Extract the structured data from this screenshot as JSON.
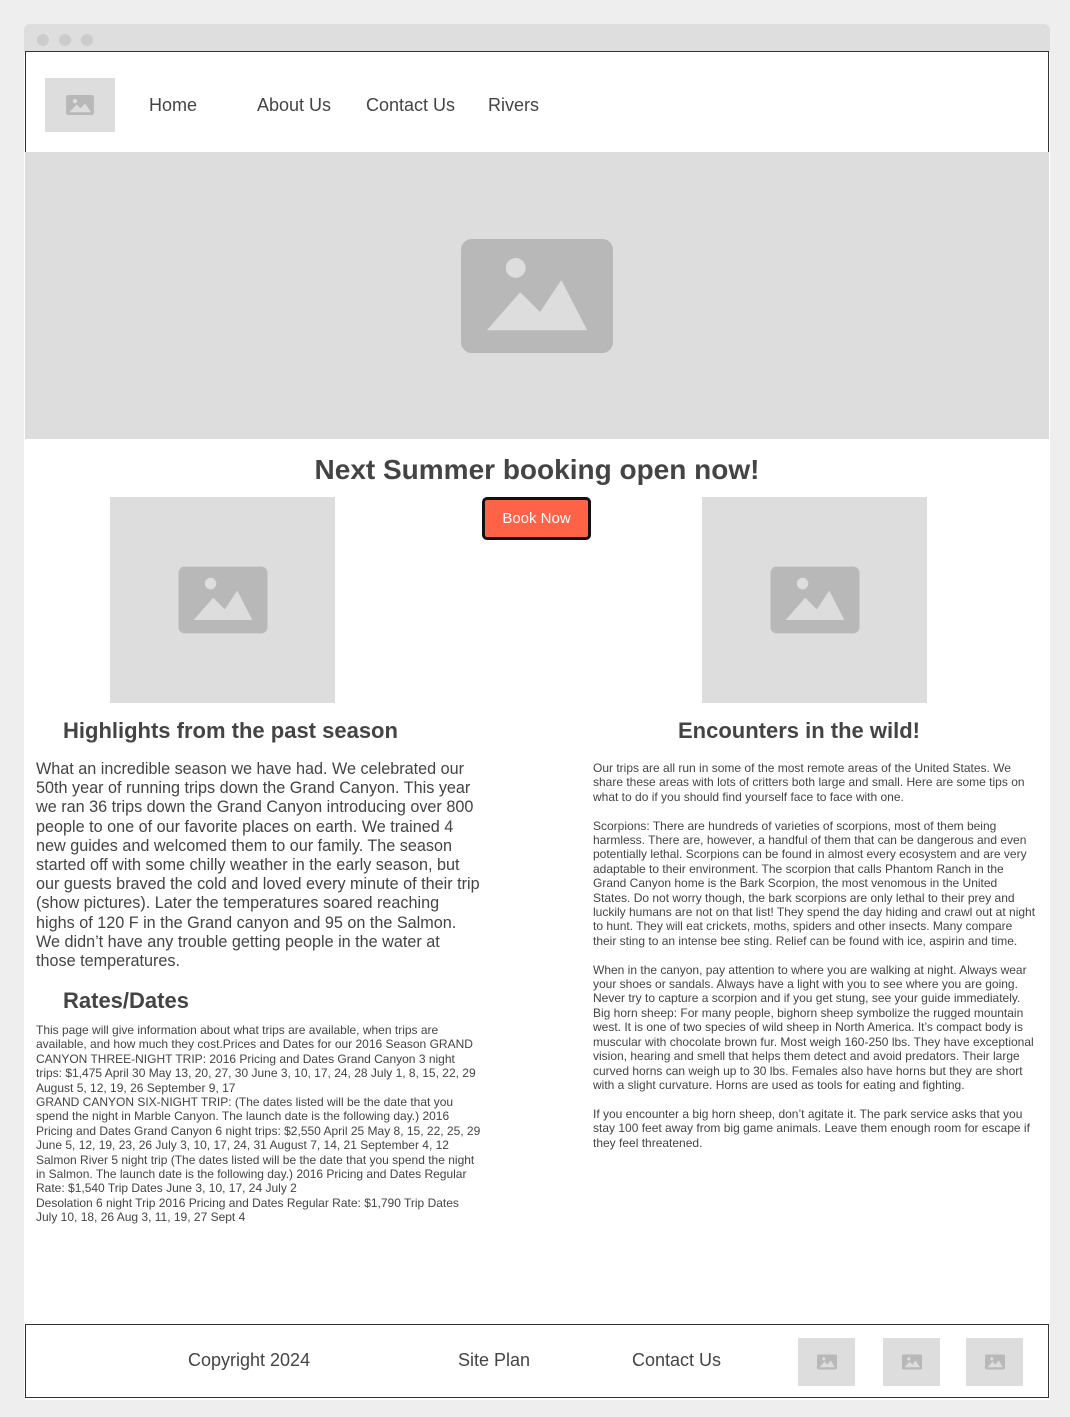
{
  "header": {
    "nav": [
      "Home",
      "About Us",
      "Contact Us",
      "Rivers"
    ]
  },
  "main": {
    "headline": "Next Summer booking open now!",
    "book_button": "Book Now",
    "highlights": {
      "title": "Highlights from the past season",
      "body": "What an incredible season we have had. We celebrated our 50th year of running trips down the Grand Canyon. This year we ran 36 trips down the Grand Canyon introducing over 800 people to one of our favorite places on earth. We trained 4 new guides and welcomed them to our family. The season started off with some chilly weather in the early season, but our guests braved the cold and loved every minute of their trip (show pictures). Later the temperatures soared reaching highs of 120 F in the Grand canyon and 95 on the Salmon. We didn’t have any trouble getting people in the water at those temperatures."
    },
    "rates": {
      "title": "Rates/Dates",
      "lines": [
        "This page will give information about what trips are available, when trips are available, and how much they cost.Prices and Dates for our 2016 Season GRAND CANYON THREE-NIGHT TRIP: 2016 Pricing and Dates Grand Canyon 3 night trips: $1,475 April 30 May 13, 20, 27, 30 June 3, 10, 17, 24, 28 July 1, 8, 15, 22, 29 August 5, 12, 19, 26 September 9, 17",
        "GRAND CANYON SIX-NIGHT TRIP: (The dates listed will be the date that you spend the night in Marble Canyon. The launch date is the following day.) 2016 Pricing and Dates Grand Canyon 6 night trips: $2,550 April 25 May 8, 15, 22, 25, 29 June 5, 12, 19, 23, 26 July 3, 10, 17, 24, 31 August 7, 14, 21 September 4, 12",
        "Salmon River 5 night trip (The dates listed will be the date that you spend the night in Salmon. The launch date is the following day.) 2016 Pricing and Dates Regular Rate: $1,540 Trip Dates June 3, 10, 17, 24 July 2",
        "Desolation 6 night Trip 2016 Pricing and Dates Regular Rate: $1,790 Trip Dates July 10, 18, 26 Aug 3, 11, 19, 27 Sept 4"
      ]
    },
    "encounters": {
      "title": "Encounters in the wild!",
      "paragraphs": [
        "Our trips are all run in some of the most remote areas of the United States. We share these areas with lots of critters both large and small. Here are some tips on what to do if you should find yourself face to face with one.",
        "Scorpions: There are hundreds of varieties of scorpions, most of them being harmless. There are, however, a handful of them that can be dangerous and even potentially lethal. Scorpions can be found in almost every ecosystem and are very adaptable to their environment. The scorpion that calls Phantom Ranch in the Grand Canyon home is the Bark Scorpion, the most venomous in the United States. Do not worry though, the bark scorpions are only lethal to their prey and luckily humans are not on that list! They spend the day hiding and crawl out at night to hunt. They will eat crickets, moths, spiders and other insects. Many compare their sting to an intense bee sting. Relief can be found with ice, aspirin and time.",
        "When in the canyon, pay attention to where you are walking at night. Always wear your shoes or sandals. Always have a light with you to see where you are going. Never try to capture a scorpion and if you get stung, see your guide immediately. Big horn sheep: For many people, bighorn sheep symbolize the rugged mountain west. It is one of two species of wild sheep in North America. It’s compact body is muscular with chocolate brown fur. Most weigh 160-250 lbs. They have exceptional vision, hearing and smell that helps them detect and avoid predators. Their large curved horns can weigh up to 30 lbs. Females also have horns but they are short with a slight curvature. Horns are used as tools for eating and fighting.",
        "If you encounter a big horn sheep, don’t agitate it. The park service asks that you stay 100 feet away from big game animals. Leave them enough room for escape if they feel threatened."
      ]
    }
  },
  "footer": {
    "copyright": "Copyright 2024",
    "site_plan": "Site Plan",
    "contact": "Contact Us",
    "social_icons": [
      "image-icon",
      "image-icon",
      "image-icon"
    ]
  },
  "colors": {
    "accent": "#ff6347",
    "placeholder_bg": "#dddddd",
    "placeholder_icon": "#b8b8b8",
    "text": "#444444"
  }
}
